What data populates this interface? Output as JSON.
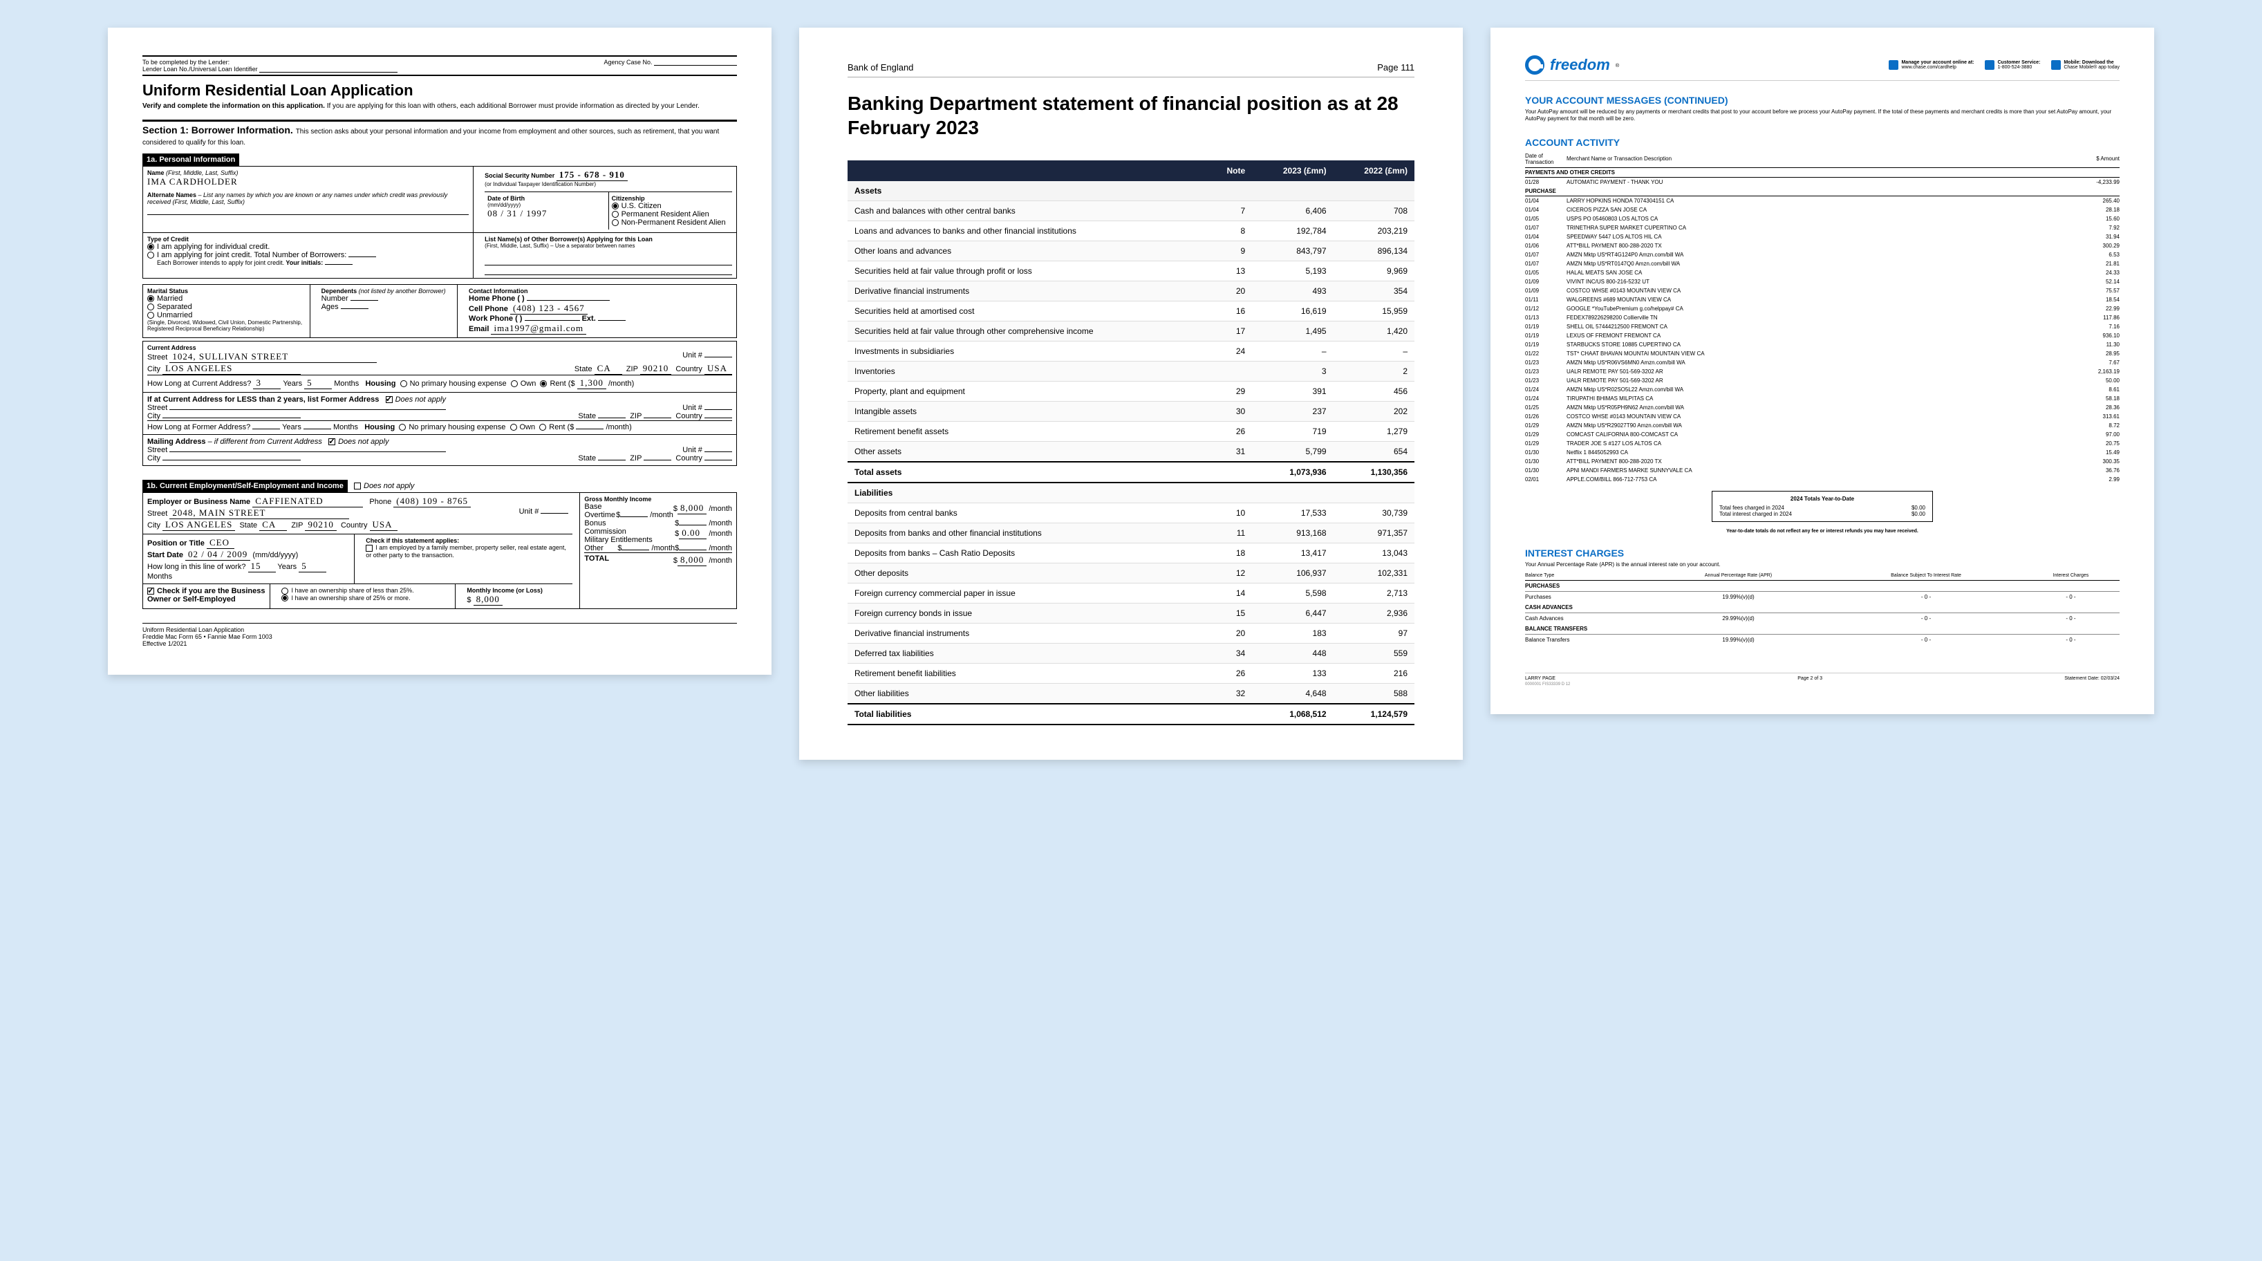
{
  "doc1": {
    "topbar": {
      "lender_label": "To be completed by the Lender:",
      "loan_no_label": "Lender Loan No./Universal Loan Identifier",
      "agency_label": "Agency Case No."
    },
    "title": "Uniform Residential Loan Application",
    "intro_bold": "Verify and complete the information on this application.",
    "intro_rest": " If you are applying for this loan with others, each additional Borrower must provide information as directed by your Lender.",
    "section1_title": "Section 1: Borrower Information.",
    "section1_sub": "This section asks about your personal information and your income from employment and other sources, such as retirement, that you want considered to qualify for this loan.",
    "bar1a": "1a. Personal Information",
    "name_label": "Name",
    "name_paren": "(First, Middle, Last, Suffix)",
    "name_val": "IMA CARDHOLDER",
    "alt_label": "Alternate Names",
    "alt_sub": " – List any names by which you are known or any names under which credit was previously received (First, Middle, Last, Suffix)",
    "ssn_label": "Social Security Number",
    "ssn_val": "175 - 678 - 910",
    "ssn_sub": "(or Individual Taxpayer Identification Number)",
    "dob_label": "Date of Birth",
    "dob_sub": "(mm/dd/yyyy)",
    "dob_val": "08 / 31 / 1997",
    "citizen_label": "Citizenship",
    "citizen_opts": [
      "U.S. Citizen",
      "Permanent Resident Alien",
      "Non-Permanent Resident Alien"
    ],
    "credit_label": "Type of Credit",
    "credit_ind": "I am applying for individual credit.",
    "credit_joint": "I am applying for joint credit.",
    "credit_joint_sub": " Total Number of Borrowers:",
    "credit_joint_note": "Each Borrower intends to apply for joint credit.",
    "credit_initials": " Your initials:",
    "other_label": "List Name(s) of Other Borrower(s) Applying for this Loan",
    "other_sub": "(First, Middle, Last, Suffix) – Use a separator between names",
    "marital_label": "Marital Status",
    "marital_opts": [
      "Married",
      "Separated",
      "Unmarried"
    ],
    "marital_note": "(Single, Divorced, Widowed, Civil Union, Domestic Partnership, Registered Reciprocal Beneficiary Relationship)",
    "dep_label": "Dependents",
    "dep_sub": "(not listed by another Borrower)",
    "dep_number": "Number",
    "dep_ages": "Ages",
    "contact_label": "Contact Information",
    "home_phone": "Home Phone (        )",
    "cell_phone": "Cell Phone",
    "cell_val": "(408) 123 - 4567",
    "work_phone": "Work Phone (        )",
    "ext": "Ext.",
    "email_label": "Email",
    "email_val": "ima1997@gmail.com",
    "addr_label": "Current Address",
    "street_label": "Street",
    "street_val": "1024, SULLIVAN STREET",
    "unit_label": "Unit #",
    "city_label": "City",
    "city_val": "LOS ANGELES",
    "state_label": "State",
    "state_val": "CA",
    "zip_label": "ZIP",
    "zip_val": "90210",
    "country_label": "Country",
    "country_val": "USA",
    "howlong_label": "How Long at Current Address?",
    "years_val": "3",
    "years_label": "Years",
    "months_val": "5",
    "months_label": "Months",
    "housing_label": "Housing",
    "housing_opts": [
      "No primary housing expense",
      "Own",
      "Rent"
    ],
    "rent_val": "1,300",
    "month_label": "/month",
    "former_label": "If at Current Address for LESS than 2 years, list Former Address",
    "dna": "Does not apply",
    "mailing_label": "Mailing Address",
    "mailing_sub": " – if different from Current Address",
    "bar1b": "1b. Current Employment/Self-Employment and Income",
    "emp_label": "Employer or Business Name",
    "emp_val": "CAFFIENATED",
    "phone_label": "Phone",
    "phone_val": "(408) 109 - 8765",
    "emp_street_val": "2048, MAIN STREET",
    "emp_city_val": "LOS ANGELES",
    "emp_state_val": "CA",
    "emp_zip_val": "90210",
    "emp_country_val": "USA",
    "pos_label": "Position or Title",
    "pos_val": "CEO",
    "start_label": "Start Date",
    "start_val": "02 / 04 / 2009",
    "start_sub": "(mm/dd/yyyy)",
    "line_label": "How long in this line of work?",
    "line_years": "15",
    "line_months": "5",
    "stmt_label": "Check if this statement applies:",
    "stmt_opt1": "I am employed by a family member, property seller, real estate agent, or other party to the transaction.",
    "gmi_label": "Gross Monthly Income",
    "base_label": "Base",
    "base_val": "8,000",
    "ot_label": "Overtime",
    "bonus_label": "Bonus",
    "comm_label": "Commission",
    "comm_val": "0.00",
    "mil_label": "Military Entitlements",
    "other_inc": "Other",
    "total_label": "TOTAL",
    "total_val": "8,000",
    "owner_label": "Check if you are the Business Owner or Self-Employed",
    "owner_opt1": "I have an ownership share of less than 25%.",
    "owner_opt2": "I have an ownership share of 25% or more.",
    "owner_val": "8,000",
    "mil_label2": "Monthly Income (or Loss)",
    "footer1": "Uniform Residential Loan Application",
    "footer2": "Freddie Mac Form 65 • Fannie Mae Form 1003",
    "footer3": "Effective 1/2021"
  },
  "doc2": {
    "org": "Bank of England",
    "pageno": "Page 111",
    "title": "Banking Department statement of financial position as at 28 February 2023",
    "headers": [
      "",
      "Note",
      "2023 (£mn)",
      "2022 (£mn)"
    ],
    "chart_data": {
      "type": "table",
      "sections": [
        {
          "title": "Assets",
          "rows": [
            [
              "Cash and balances with other central banks",
              "7",
              "6,406",
              "708"
            ],
            [
              "Loans and advances to banks and other financial institutions",
              "8",
              "192,784",
              "203,219"
            ],
            [
              "Other loans and advances",
              "9",
              "843,797",
              "896,134"
            ],
            [
              "Securities held at fair value through profit or loss",
              "13",
              "5,193",
              "9,969"
            ],
            [
              "Derivative financial instruments",
              "20",
              "493",
              "354"
            ],
            [
              "Securities held at amortised cost",
              "16",
              "16,619",
              "15,959"
            ],
            [
              "Securities held at fair value through other comprehensive income",
              "17",
              "1,495",
              "1,420"
            ],
            [
              "Investments in subsidiaries",
              "24",
              "–",
              "–"
            ],
            [
              "Inventories",
              "",
              "3",
              "2"
            ],
            [
              "Property, plant and equipment",
              "29",
              "391",
              "456"
            ],
            [
              "Intangible assets",
              "30",
              "237",
              "202"
            ],
            [
              "Retirement benefit assets",
              "26",
              "719",
              "1,279"
            ],
            [
              "Other assets",
              "31",
              "5,799",
              "654"
            ]
          ],
          "total": [
            "Total assets",
            "",
            "1,073,936",
            "1,130,356"
          ]
        },
        {
          "title": "Liabilities",
          "rows": [
            [
              "Deposits from central banks",
              "10",
              "17,533",
              "30,739"
            ],
            [
              "Deposits from banks and other financial institutions",
              "11",
              "913,168",
              "971,357"
            ],
            [
              "Deposits from banks – Cash Ratio Deposits",
              "18",
              "13,417",
              "13,043"
            ],
            [
              "Other deposits",
              "12",
              "106,937",
              "102,331"
            ],
            [
              "Foreign currency commercial paper in issue",
              "14",
              "5,598",
              "2,713"
            ],
            [
              "Foreign currency bonds in issue",
              "15",
              "6,447",
              "2,936"
            ],
            [
              "Derivative financial instruments",
              "20",
              "183",
              "97"
            ],
            [
              "Deferred tax liabilities",
              "34",
              "448",
              "559"
            ],
            [
              "Retirement benefit liabilities",
              "26",
              "133",
              "216"
            ],
            [
              "Other liabilities",
              "32",
              "4,648",
              "588"
            ]
          ],
          "total": [
            "Total liabilities",
            "",
            "1,068,512",
            "1,124,579"
          ]
        }
      ]
    }
  },
  "doc3": {
    "brand": "freedom",
    "trademark": "®",
    "hdr_items": [
      {
        "bold": "Manage your account online at:",
        "sub": "www.chase.com/cardhelp"
      },
      {
        "bold": "Customer Service:",
        "sub": "1-800-524-3880"
      },
      {
        "bold": "Mobile: Download the",
        "sub": "Chase Mobile® app today"
      }
    ],
    "msg_title": "YOUR ACCOUNT MESSAGES  (CONTINUED)",
    "msg_body": "Your AutoPay amount will be reduced by any payments or merchant credits that post to your account before we process your AutoPay payment. If the total of these payments and merchant credits is more than your set AutoPay amount, your AutoPay payment for that month will be zero.",
    "activity_title": "ACCOUNT ACTIVITY",
    "col_date": "Date of Transaction",
    "col_desc": "Merchant Name or Transaction Description",
    "col_amt": "$ Amount",
    "sub_payments": "PAYMENTS AND OTHER CREDITS",
    "payment_row": [
      "01/28",
      "AUTOMATIC PAYMENT - THANK YOU",
      "-4,233.99"
    ],
    "sub_purchase": "PURCHASE",
    "purchases": [
      [
        "01/04",
        "LARRY HOPKINS HONDA 7074304151 CA",
        "265.40"
      ],
      [
        "01/04",
        "CICEROS PIZZA SAN JOSE CA",
        "28.18"
      ],
      [
        "01/05",
        "USPS PO 05460803 LOS ALTOS CA",
        "15.60"
      ],
      [
        "01/07",
        "TRINETHRA SUPER MARKET CUPERTINO CA",
        "7.92"
      ],
      [
        "01/04",
        "SPEEDWAY 5447 LOS ALTOS HIL CA",
        "31.94"
      ],
      [
        "01/06",
        "ATT*BILL PAYMENT 800-288-2020 TX",
        "300.29"
      ],
      [
        "01/07",
        "AMZN Mktp US*RT4G124P0 Amzn.com/bill WA",
        "6.53"
      ],
      [
        "01/07",
        "AMZN Mktp US*RT0147Q0 Amzn.com/bill WA",
        "21.81"
      ],
      [
        "01/05",
        "HALAL MEATS SAN JOSE CA",
        "24.33"
      ],
      [
        "01/09",
        "VIVINT INC/US 800-216-5232 UT",
        "52.14"
      ],
      [
        "01/09",
        "COSTCO WHSE #0143 MOUNTAIN VIEW CA",
        "75.57"
      ],
      [
        "01/11",
        "WALGREENS #689 MOUNTAIN VIEW CA",
        "18.54"
      ],
      [
        "01/12",
        "GOOGLE *YouTubePremium g.co/helppay# CA",
        "22.99"
      ],
      [
        "01/13",
        "FEDEX789226298200 Collierville TN",
        "117.86"
      ],
      [
        "01/19",
        "SHELL OIL 57444212500 FREMONT CA",
        "7.16"
      ],
      [
        "01/19",
        "LEXUS OF FREMONT FREMONT CA",
        "936.10"
      ],
      [
        "01/19",
        "STARBUCKS STORE 10885 CUPERTINO CA",
        "11.30"
      ],
      [
        "01/22",
        "TST* CHAAT BHAVAN MOUNTAI MOUNTAIN VIEW CA",
        "28.95"
      ],
      [
        "01/23",
        "AMZN Mktp US*R06VS6MN0 Amzn.com/bill WA",
        "7.67"
      ],
      [
        "01/23",
        "UALR REMOTE PAY 501-569-3202 AR",
        "2,163.19"
      ],
      [
        "01/23",
        "UALR REMOTE PAY 501-569-3202 AR",
        "50.00"
      ],
      [
        "01/24",
        "AMZN Mktp US*R02SO5L22 Amzn.com/bill WA",
        "8.61"
      ],
      [
        "01/24",
        "TIRUPATHI BHIMAS MILPITAS CA",
        "58.18"
      ],
      [
        "01/25",
        "AMZN Mktp US*R05PH9N62 Amzn.com/bill WA",
        "28.36"
      ],
      [
        "01/26",
        "COSTCO WHSE #0143 MOUNTAIN VIEW CA",
        "313.61"
      ],
      [
        "01/29",
        "AMZN Mktp US*R29027T90 Amzn.com/bill WA",
        "8.72"
      ],
      [
        "01/29",
        "COMCAST CALIFORNIA 800-COMCAST CA",
        "97.00"
      ],
      [
        "01/29",
        "TRADER JOE S #127 LOS ALTOS CA",
        "20.75"
      ],
      [
        "01/30",
        "Netflix 1 8445052993 CA",
        "15.49"
      ],
      [
        "01/30",
        "ATT*BILL PAYMENT 800-288-2020 TX",
        "300.35"
      ],
      [
        "01/30",
        "APNI MANDI FARMERS MARKE SUNNYVALE CA",
        "36.76"
      ],
      [
        "02/01",
        "APPLE.COM/BILL 866-712-7753 CA",
        "2.99"
      ]
    ],
    "ytd_title": "2024 Totals Year-to-Date",
    "ytd_rows": [
      [
        "Total fees charged in 2024",
        "$0.00"
      ],
      [
        "Total interest charged in 2024",
        "$0.00"
      ]
    ],
    "ytd_note": "Year-to-date totals do not reflect any fee or interest refunds you may have received.",
    "int_title": "INTEREST CHARGES",
    "int_sub": "Your Annual Percentage Rate (APR) is the annual interest rate on your account.",
    "rate_headers": [
      "Balance Type",
      "Annual Percentage Rate (APR)",
      "Balance Subject To Interest Rate",
      "Interest Charges"
    ],
    "rate_sections": [
      {
        "cat": "PURCHASES",
        "rows": [
          [
            "Purchases",
            "19.99%(v)(d)",
            "- 0 -",
            "- 0 -"
          ]
        ]
      },
      {
        "cat": "CASH ADVANCES",
        "rows": [
          [
            "Cash Advances",
            "29.99%(v)(d)",
            "- 0 -",
            "- 0 -"
          ]
        ]
      },
      {
        "cat": "BALANCE TRANSFERS",
        "rows": [
          [
            "Balance Transfers",
            "19.99%(v)(d)",
            "- 0 -",
            "- 0 -"
          ]
        ]
      }
    ],
    "footer_name": "LARRY PAGE",
    "footer_left": "0000001  FIS33339 D 12",
    "footer_mid": "Page 2 of 3",
    "footer_acct": "Statement Date:  02/03/24"
  }
}
